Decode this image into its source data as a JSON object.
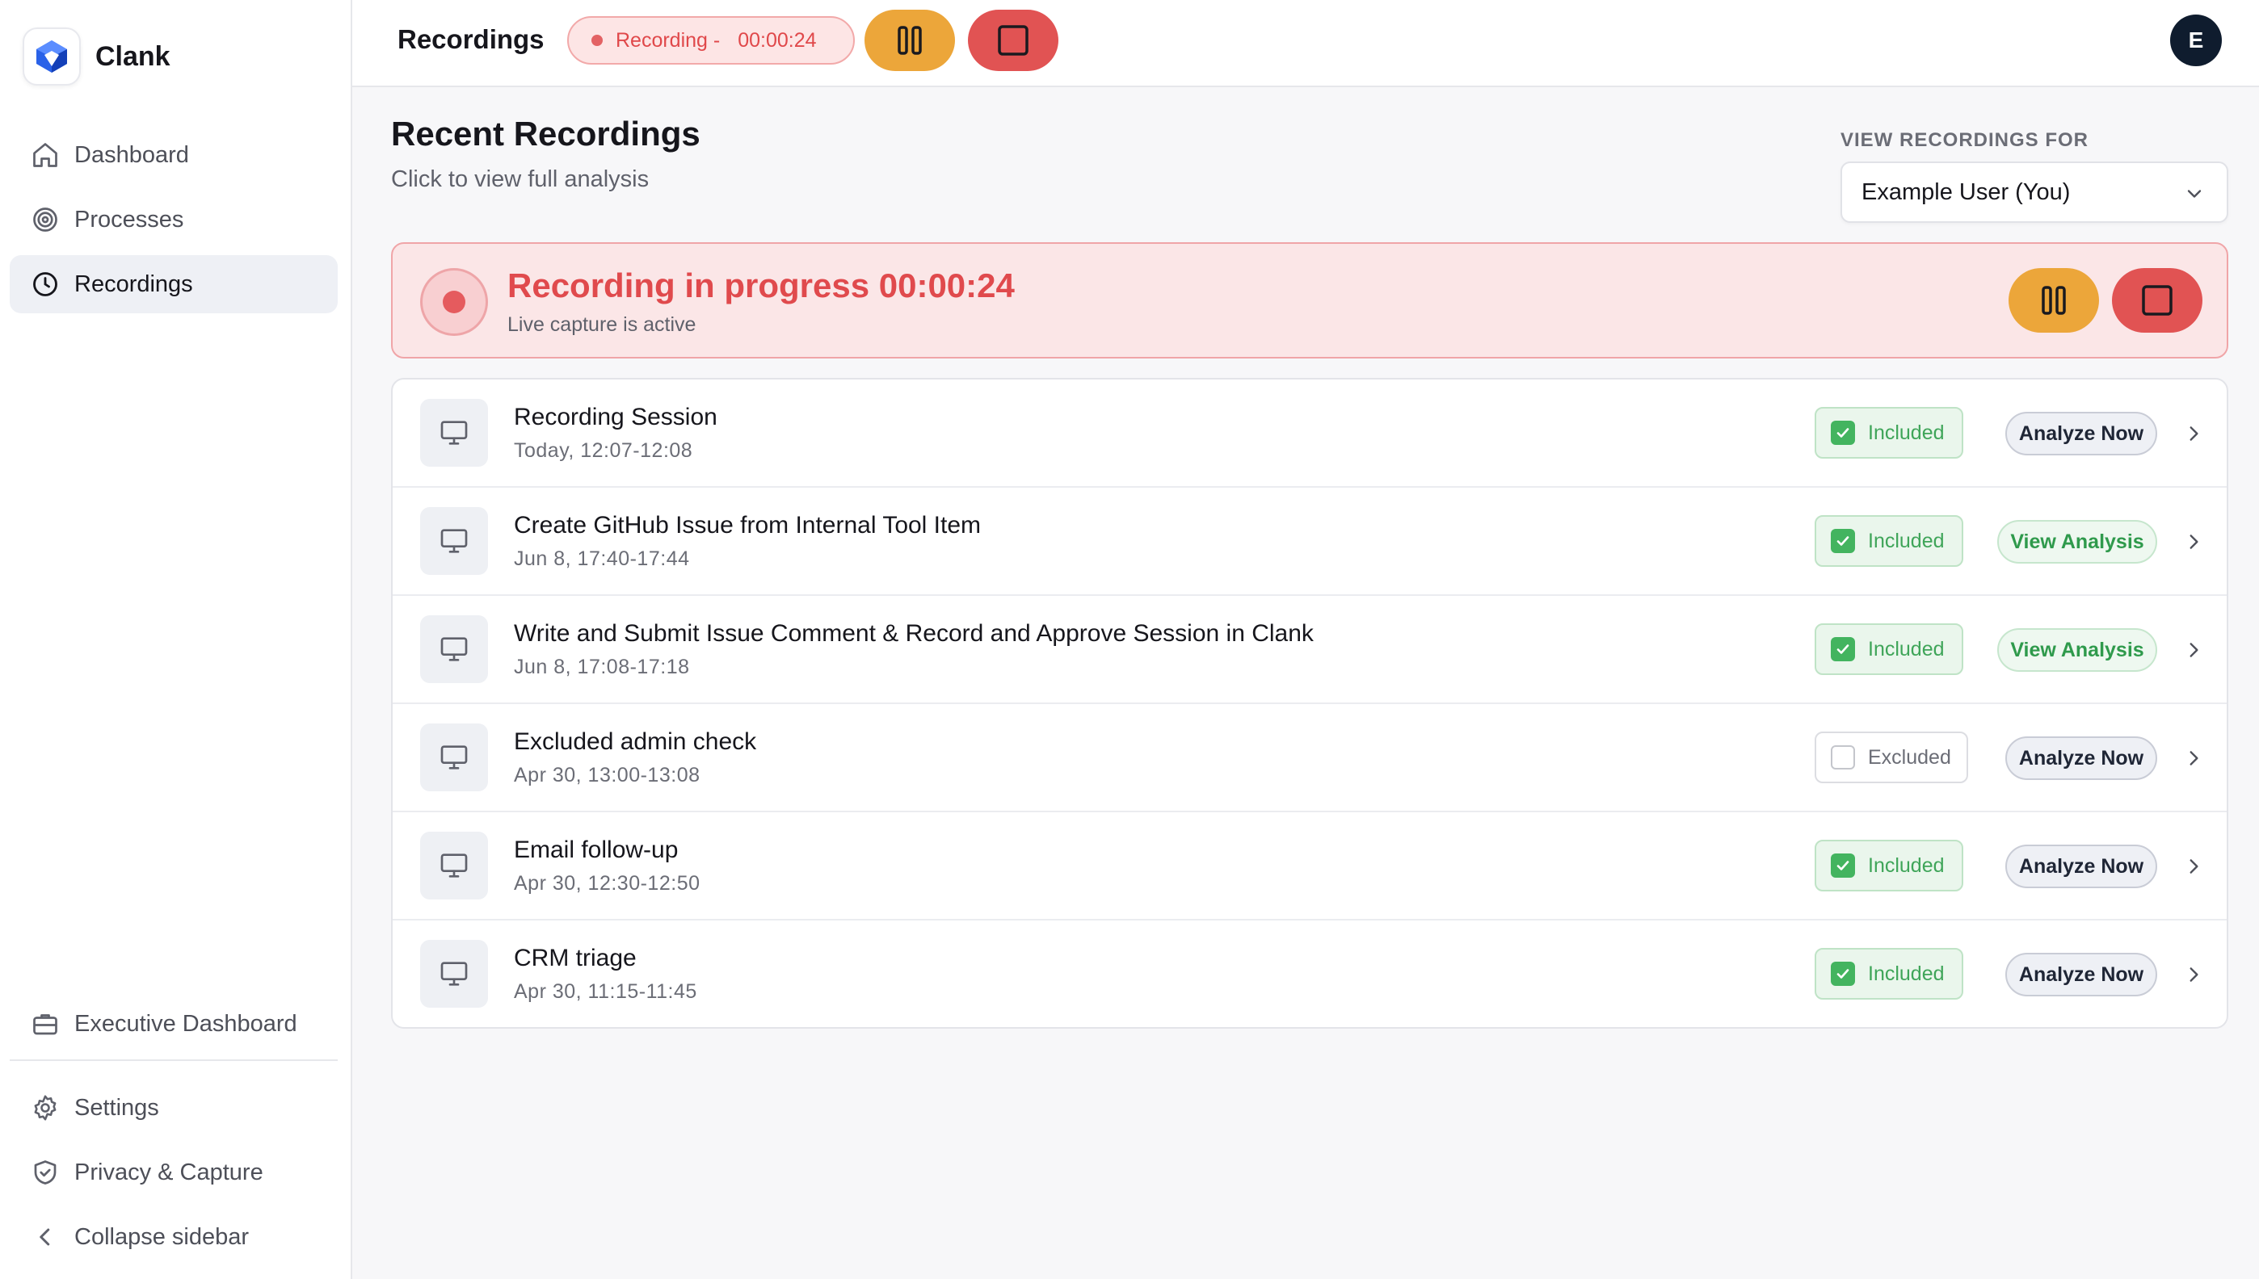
{
  "app": {
    "name": "Clank"
  },
  "sidebar": {
    "items": [
      {
        "label": "Dashboard",
        "icon": "home-icon"
      },
      {
        "label": "Processes",
        "icon": "target-icon"
      },
      {
        "label": "Recordings",
        "icon": "clock-icon",
        "active": true
      }
    ],
    "bottom_items": [
      {
        "label": "Executive Dashboard",
        "icon": "briefcase-icon"
      },
      {
        "label": "Settings",
        "icon": "gear-icon"
      },
      {
        "label": "Privacy & Capture",
        "icon": "shield-icon"
      },
      {
        "label": "Collapse sidebar",
        "icon": "chevron-left-icon"
      }
    ]
  },
  "topbar": {
    "title": "Recordings",
    "recording_label": "Recording -",
    "recording_time": "00:00:24",
    "avatar_initial": "E"
  },
  "main": {
    "title": "Recent Recordings",
    "subtitle": "Click to view full analysis",
    "filter_label": "VIEW RECORDINGS FOR",
    "filter_value": "Example User (You)"
  },
  "banner": {
    "title": "Recording in progress 00:00:24",
    "subtitle": "Live capture is active"
  },
  "recordings": [
    {
      "title": "Recording Session",
      "date": "Today, 12:07-12:08",
      "status": "Included",
      "action": "Analyze Now"
    },
    {
      "title": "Create GitHub Issue from Internal Tool Item",
      "date": "Jun 8, 17:40-17:44",
      "status": "Included",
      "action": "View Analysis"
    },
    {
      "title": "Write and Submit Issue Comment & Record and Approve Session in Clank",
      "date": "Jun 8, 17:08-17:18",
      "status": "Included",
      "action": "View Analysis"
    },
    {
      "title": "Excluded admin check",
      "date": "Apr 30, 13:00-13:08",
      "status": "Excluded",
      "action": "Analyze Now"
    },
    {
      "title": "Email follow-up",
      "date": "Apr 30, 12:30-12:50",
      "status": "Included",
      "action": "Analyze Now"
    },
    {
      "title": "CRM triage",
      "date": "Apr 30, 11:15-11:45",
      "status": "Included",
      "action": "Analyze Now"
    }
  ],
  "colors": {
    "accent_recording": "#e04a4d",
    "pause": "#eca63a",
    "stop": "#e15353",
    "included": "#43b45f"
  }
}
